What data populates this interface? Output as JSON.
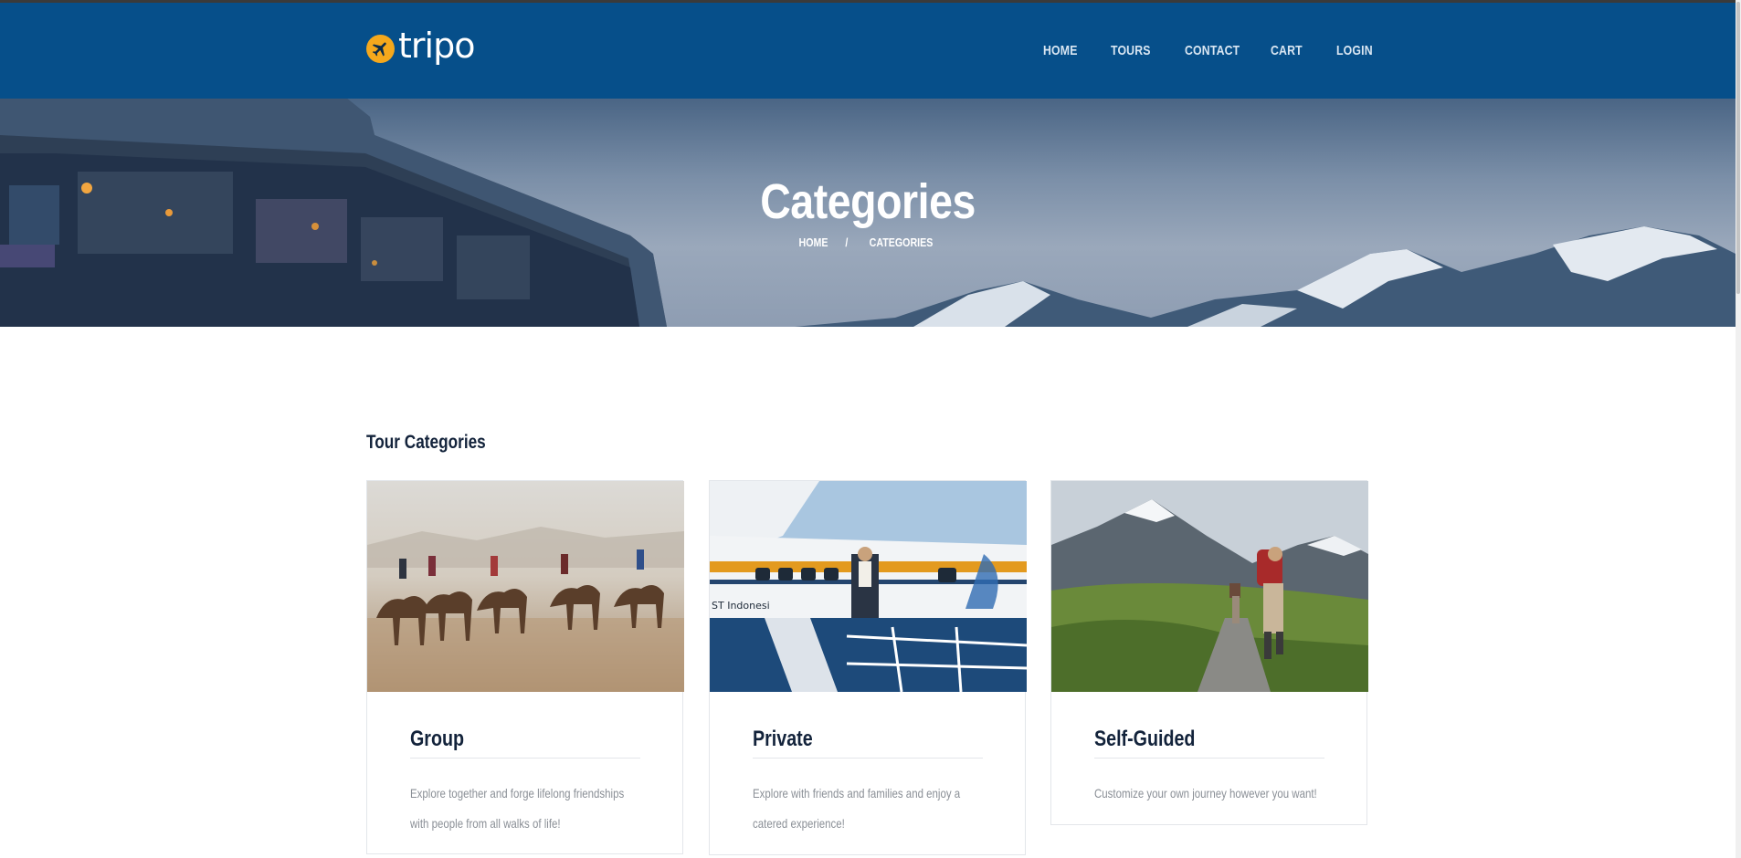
{
  "brand": {
    "name": "tripo",
    "accent": "#f5a81c",
    "header_bg": "#064f8a"
  },
  "nav": {
    "items": [
      "HOME",
      "TOURS",
      "CONTACT",
      "CART",
      "LOGIN"
    ]
  },
  "hero": {
    "title": "Categories",
    "breadcrumb": [
      "HOME",
      "/",
      "CATEGORIES"
    ]
  },
  "section": {
    "title": "Tour Categories"
  },
  "cards": [
    {
      "title": "Group",
      "description": "Explore together and forge lifelong friendships with people from all walks of life!",
      "image": "camels-desert"
    },
    {
      "title": "Private",
      "description": "Explore with friends and families and enjoy a catered experience!",
      "image": "seaplane-traveler"
    },
    {
      "title": "Self-Guided",
      "description": "Customize your own journey however you want!",
      "image": "hikers-mountains"
    }
  ]
}
